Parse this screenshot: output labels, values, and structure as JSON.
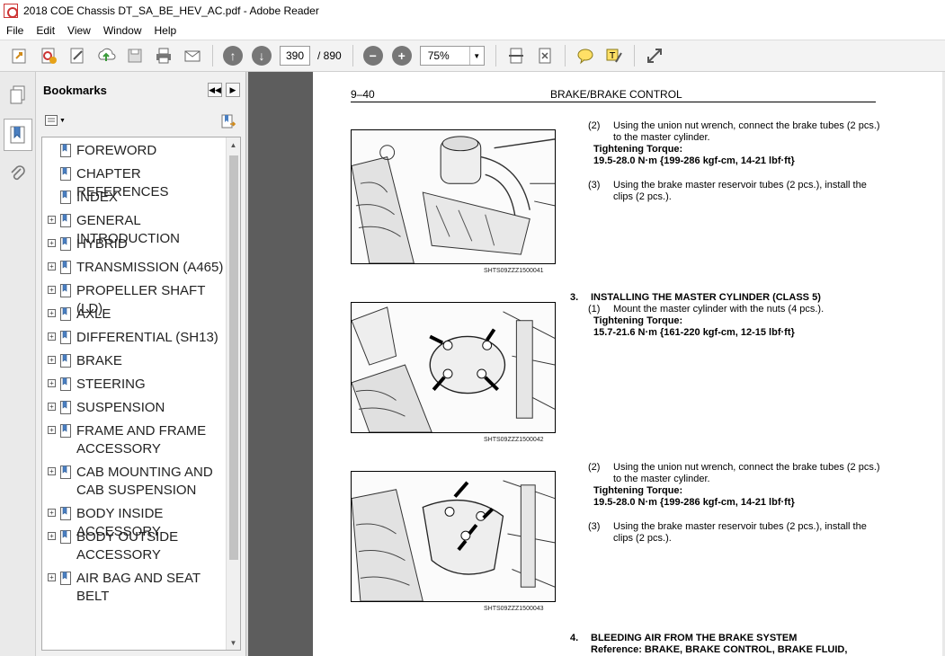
{
  "window": {
    "title": "2018 COE Chassis DT_SA_BE_HEV_AC.pdf - Adobe Reader"
  },
  "menu": [
    "File",
    "Edit",
    "View",
    "Window",
    "Help"
  ],
  "toolbar": {
    "page_current": "390",
    "page_total": "/ 890",
    "zoom": "75%"
  },
  "bookmarks": {
    "title": "Bookmarks",
    "items": [
      {
        "label": "FOREWORD",
        "expandable": false
      },
      {
        "label": "CHAPTER REFERENCES",
        "expandable": false
      },
      {
        "label": "INDEX",
        "expandable": false
      },
      {
        "label": "GENERAL INTRODUCTION",
        "expandable": true
      },
      {
        "label": "HYBRID",
        "expandable": true
      },
      {
        "label": "TRANSMISSION (A465)",
        "expandable": true
      },
      {
        "label": "PROPELLER SHAFT (LD)",
        "expandable": true
      },
      {
        "label": "AXLE",
        "expandable": true
      },
      {
        "label": "DIFFERENTIAL (SH13)",
        "expandable": true
      },
      {
        "label": "BRAKE",
        "expandable": true
      },
      {
        "label": "STEERING",
        "expandable": true
      },
      {
        "label": "SUSPENSION",
        "expandable": true
      },
      {
        "label": "FRAME AND FRAME ACCESSORY",
        "expandable": true
      },
      {
        "label": "CAB MOUNTING AND CAB SUSPENSION",
        "expandable": true
      },
      {
        "label": "BODY INSIDE ACCESSORY",
        "expandable": true
      },
      {
        "label": "BODY OUTSIDE ACCESSORY",
        "expandable": true
      },
      {
        "label": "AIR BAG AND SEAT BELT",
        "expandable": true
      }
    ]
  },
  "document": {
    "page_number": "9–40",
    "section_title": "BRAKE/BRAKE CONTROL",
    "captions": [
      "SHTS09ZZZ1500041",
      "SHTS09ZZZ1500042",
      "SHTS09ZZZ1500043"
    ],
    "block1": {
      "step2_num": "(2)",
      "step2_l1": "Using the union nut wrench, connect the brake tubes (2 pcs.)",
      "step2_l2": "to the master cylinder.",
      "torque_label": "Tightening Torque:",
      "torque_value": "19.5-28.0 N·m {199-286 kgf-cm, 14-21 lbf·ft}",
      "step3_num": "(3)",
      "step3_l1": "Using the brake master reservoir tubes (2 pcs.), install the",
      "step3_l2": "clips (2 pcs.)."
    },
    "block2": {
      "heading_num": "3.",
      "heading": "INSTALLING THE MASTER CYLINDER (CLASS 5)",
      "step1_num": "(1)",
      "step1": "Mount the master cylinder with the nuts (4 pcs.).",
      "torque_label": "Tightening Torque:",
      "torque_value": "15.7-21.6 N·m {161-220 kgf-cm, 12-15 lbf·ft}"
    },
    "block3": {
      "step2_num": "(2)",
      "step2_l1": "Using the union nut wrench, connect the brake tubes (2 pcs.)",
      "step2_l2": "to the master cylinder.",
      "torque_label": "Tightening Torque:",
      "torque_value": "19.5-28.0 N·m {199-286 kgf-cm, 14-21 lbf·ft}",
      "step3_num": "(3)",
      "step3_l1": "Using the brake master reservoir tubes (2 pcs.), install the",
      "step3_l2": "clips (2 pcs.)."
    },
    "block4": {
      "heading_num": "4.",
      "heading": "BLEEDING AIR FROM THE BRAKE SYSTEM",
      "reference": "Reference:  BRAKE,  BRAKE  CONTROL,  BRAKE  FLUID,"
    }
  }
}
